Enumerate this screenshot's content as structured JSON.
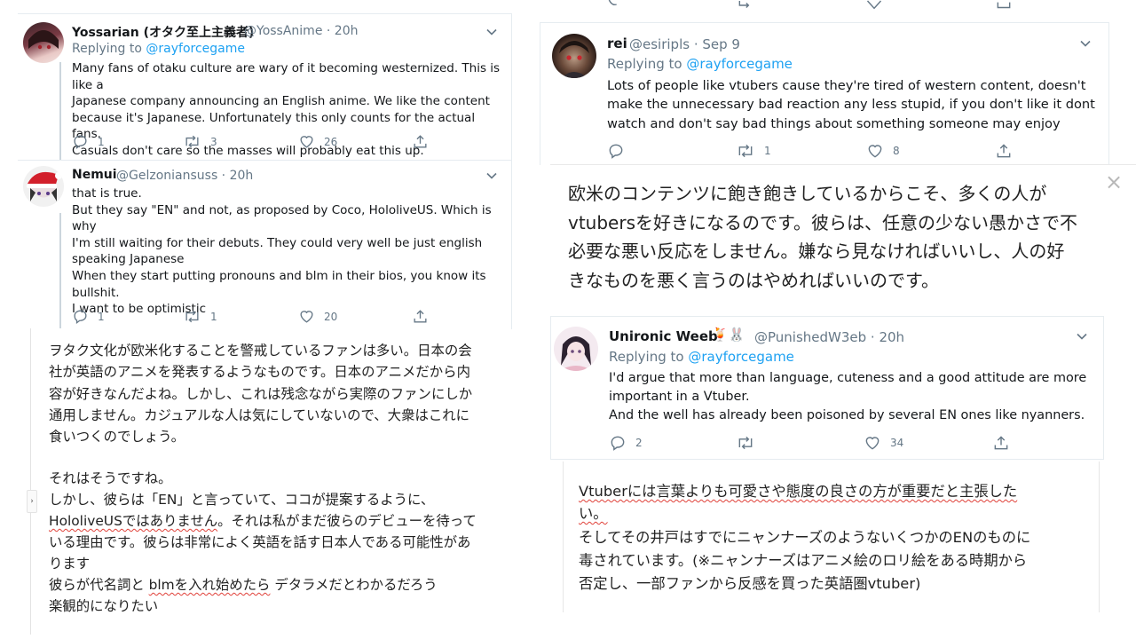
{
  "left": {
    "tweet1": {
      "name": "Yossarian (オタク至上主義者)",
      "handle": "@YossAnime · 20h",
      "replying_prefix": "Replying to ",
      "replying_to": "@rayforcegame",
      "text": "Many fans of otaku culture are wary of it becoming westernized. This is like a\nJapanese company announcing an English anime. We like the content\nbecause it's Japanese. Unfortunately this only counts for the actual fans.\nCasuals don't care so the masses will probably eat this up.",
      "replies": "1",
      "retweets": "3",
      "likes": "26"
    },
    "tweet2": {
      "name": "Nemui",
      "handle": "@Gelzoniansuss · 20h",
      "text": "that is true.\nBut they say \"EN\" and not, as proposed by Coco, HololiveUS. Which is why\nI'm still waiting for their debuts. They could very well be just english\nspeaking Japanese\nWhen they start putting pronouns and blm in their bios, you know its\nbullshit.\nI want to be optimistic",
      "replies": "1",
      "retweets": "1",
      "likes": "20"
    },
    "translation": {
      "para1": "ヲタク文化が欧米化することを警戒しているファンは多い。日本の会\n社が英語のアニメを発表するようなものです。日本のアニメだから内\n容が好きなんだよね。しかし、これは残念ながら実際のファンにしか\n通用しません。カジュアルな人は気にしていないので、大衆はこれに\n食いつくのでしょう。",
      "line1": "それはそうですね。",
      "line2": "しかし、彼らは「EN」と言っていて、ココが提案するように、",
      "line3a": "HololiveUSではありません",
      "line3b": "。それは私がまだ彼らのデビューを待って",
      "line4": "いる理由です。彼らは非常によく英語を話す日本人である可能性があ",
      "line5": "ります",
      "line6a": "彼らが代名詞と ",
      "line6b": "blmを入れ始めたら",
      "line6c": " デタラメだとわかるだろう",
      "line7": "楽観的になりたい"
    }
  },
  "right": {
    "tweet3": {
      "name": "rei",
      "handle": "@esiripls · Sep 9",
      "replying_prefix": "Replying to ",
      "replying_to": "@rayforcegame",
      "text": "Lots of people like vtubers cause they're tired of western content, doesn't\nmake the unnecessary bad reaction any less stupid, if you don't like it dont\nwatch and don't say bad things about something someone may enjoy",
      "replies": "",
      "retweets": "1",
      "likes": "8"
    },
    "translation1": {
      "text": "欧米のコンテンツに飽き飽きしているからこそ、多くの人が\nvtubersを好きになるのです。彼らは、任意の少ない愚かさで不\n必要な悪い反応をしません。嫌なら見なければいいし、人の好\nきなものを悪く言うのはやめればいいのです。",
      "close_symbol": "×"
    },
    "tweet4": {
      "name": "Unironic Weeb",
      "emoji": "🍹🐰",
      "handle": "@PunishedW3eb · 20h",
      "replying_prefix": "Replying to ",
      "replying_to": "@rayforcegame",
      "text": "I'd argue that more than language, cuteness and a good attitude are more\nimportant in a Vtuber.\nAnd the well has already been poisoned by several EN ones like nyanners.",
      "replies": "2",
      "retweets": "",
      "likes": "34"
    },
    "translation2": {
      "line1": "Vtuberには言葉よりも可愛さや態度の良さの方が重要だと主張した",
      "line2": "い。",
      "line3": "そしてその井戸はすでにニャンナーズのようないくつかのENのものに",
      "line4": "毒されています。(※ニャンナーズはアニメ絵のロリ絵をある時期から",
      "line5": "否定し、一部ファンから反感を買った英語圏vtuber)"
    }
  },
  "colors": {
    "link": "#1da1f2",
    "muted": "#657786",
    "text": "#14171a",
    "border": "#e6ecf0",
    "spellcheck": "#e0413a"
  },
  "icons": [
    "reply-icon",
    "retweet-icon",
    "like-icon",
    "share-icon",
    "chevron-down-icon",
    "close-icon"
  ]
}
